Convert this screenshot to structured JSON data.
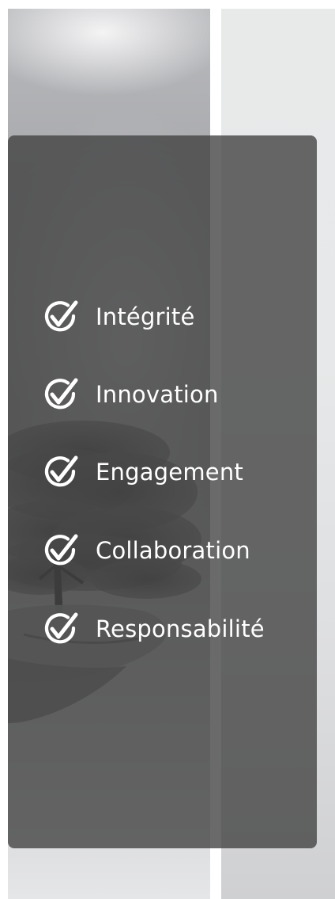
{
  "colors": {
    "panel": "#404040",
    "text": "#ffffff",
    "right_column": "#e6e8e9"
  },
  "image": {
    "description_icon": "tree-in-hands-icon"
  },
  "values": [
    {
      "label": "Intégrité",
      "icon": "check-circle-icon"
    },
    {
      "label": "Innovation",
      "icon": "check-circle-icon"
    },
    {
      "label": "Engagement",
      "icon": "check-circle-icon"
    },
    {
      "label": "Collaboration",
      "icon": "check-circle-icon"
    },
    {
      "label": "Responsabilité",
      "icon": "check-circle-icon"
    }
  ]
}
